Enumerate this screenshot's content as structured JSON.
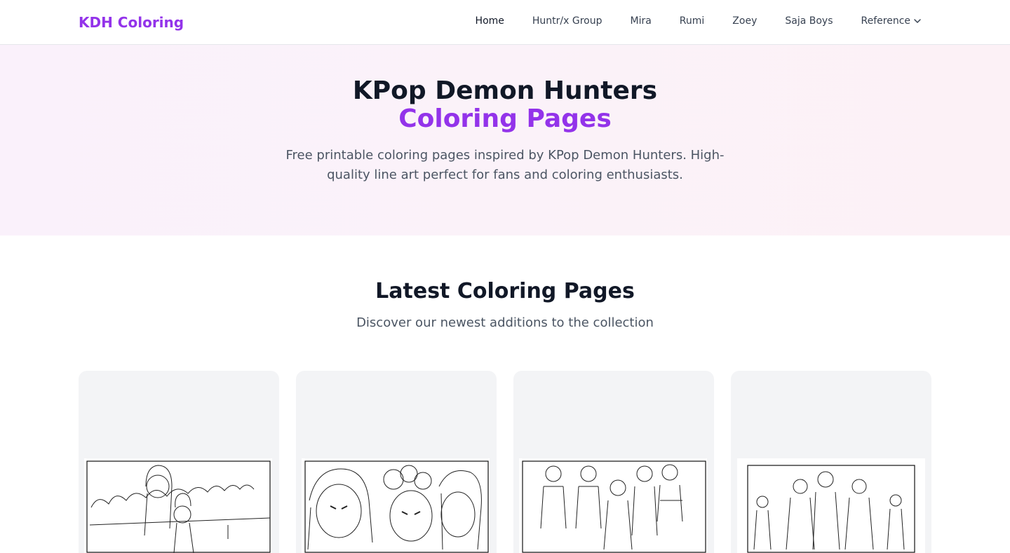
{
  "header": {
    "brand": "KDH Coloring",
    "nav": [
      {
        "label": "Home"
      },
      {
        "label": "Huntr/x Group"
      },
      {
        "label": "Mira"
      },
      {
        "label": "Rumi"
      },
      {
        "label": "Zoey"
      },
      {
        "label": "Saja Boys"
      }
    ],
    "reference_label": "Reference"
  },
  "hero": {
    "title_line1": "KPop Demon Hunters",
    "title_line2": "Coloring Pages",
    "subtitle": "Free printable coloring pages inspired by KPop Demon Hunters. High-quality line art perfect for fans and coloring enthusiasts."
  },
  "latest": {
    "title": "Latest Coloring Pages",
    "subtitle": "Discover our newest additions to the collection"
  },
  "colors": {
    "brand": "#9333ea",
    "text_dark": "#111827",
    "text_muted": "#4b5563",
    "card_bg": "#f3f4f6"
  }
}
